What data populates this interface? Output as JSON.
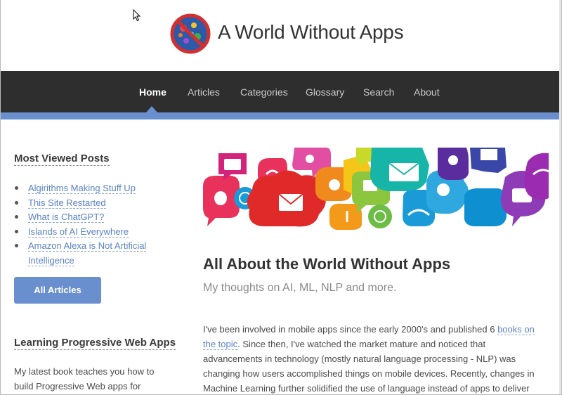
{
  "site": {
    "title": "A World Without Apps"
  },
  "nav": {
    "items": [
      {
        "label": "Home",
        "active": true
      },
      {
        "label": "Articles",
        "active": false
      },
      {
        "label": "Categories",
        "active": false
      },
      {
        "label": "Glossary",
        "active": false
      },
      {
        "label": "Search",
        "active": false
      },
      {
        "label": "About",
        "active": false
      }
    ]
  },
  "sidebar": {
    "most_viewed": {
      "title": "Most Viewed Posts",
      "posts": [
        "Algirithms Making Stuff Up",
        "This Site Restarted",
        "What is ChatGPT?",
        "Islands of AI Everywhere",
        "Amazon Alexa is Not Artificial Intelligence"
      ],
      "button_label": "All Articles"
    },
    "book": {
      "title": "Learning Progressive Web Apps",
      "text": "My latest book teaches you how to build Progressive Web apps for desktops and"
    }
  },
  "main": {
    "title": "All About the World Without Apps",
    "subtitle": "My thoughts on AI, ML, NLP and more.",
    "intro_before": "I've been involved in mobile apps since the early 2000's and published 6 ",
    "intro_link": "books on the topic",
    "intro_after": ". Since then, I've watched the market mature and noticed that advancements in technology (mostly natural language processing - NLP) was changing how users accomplished things on mobile devices. Recently, changes in Machine Learning further solidified the use of language instead of apps to deliver results on mobile devices,"
  },
  "colors": {
    "accent": "#6a8fcf",
    "nav_bg": "#2e2e2e",
    "link": "#5a82c4"
  }
}
